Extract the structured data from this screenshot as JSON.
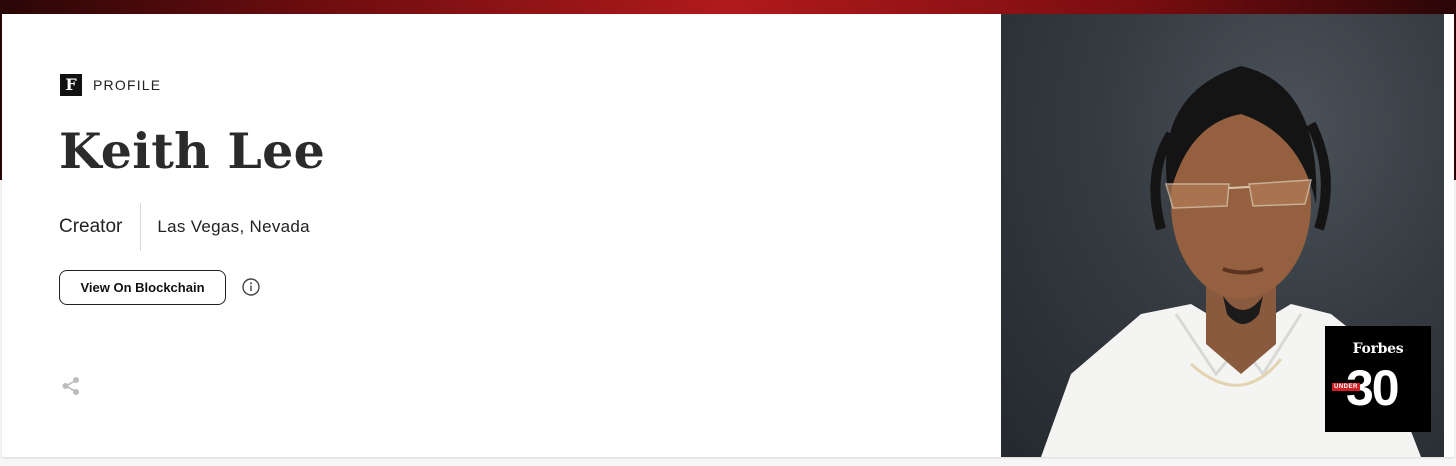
{
  "profile": {
    "logo_letter": "F",
    "eyebrow": "PROFILE",
    "name": "Keith Lee",
    "role": "Creator",
    "location": "Las Vegas, Nevada"
  },
  "actions": {
    "blockchain_label": "View On Blockchain",
    "info_icon": "info-circle-icon",
    "share_icon": "share-icon"
  },
  "badge": {
    "brand": "Forbes",
    "under": "UNDER",
    "number": "30"
  },
  "colors": {
    "band_red": "#b11a1c",
    "text_dark": "#2b2b2b",
    "badge_red": "#d01f25"
  }
}
